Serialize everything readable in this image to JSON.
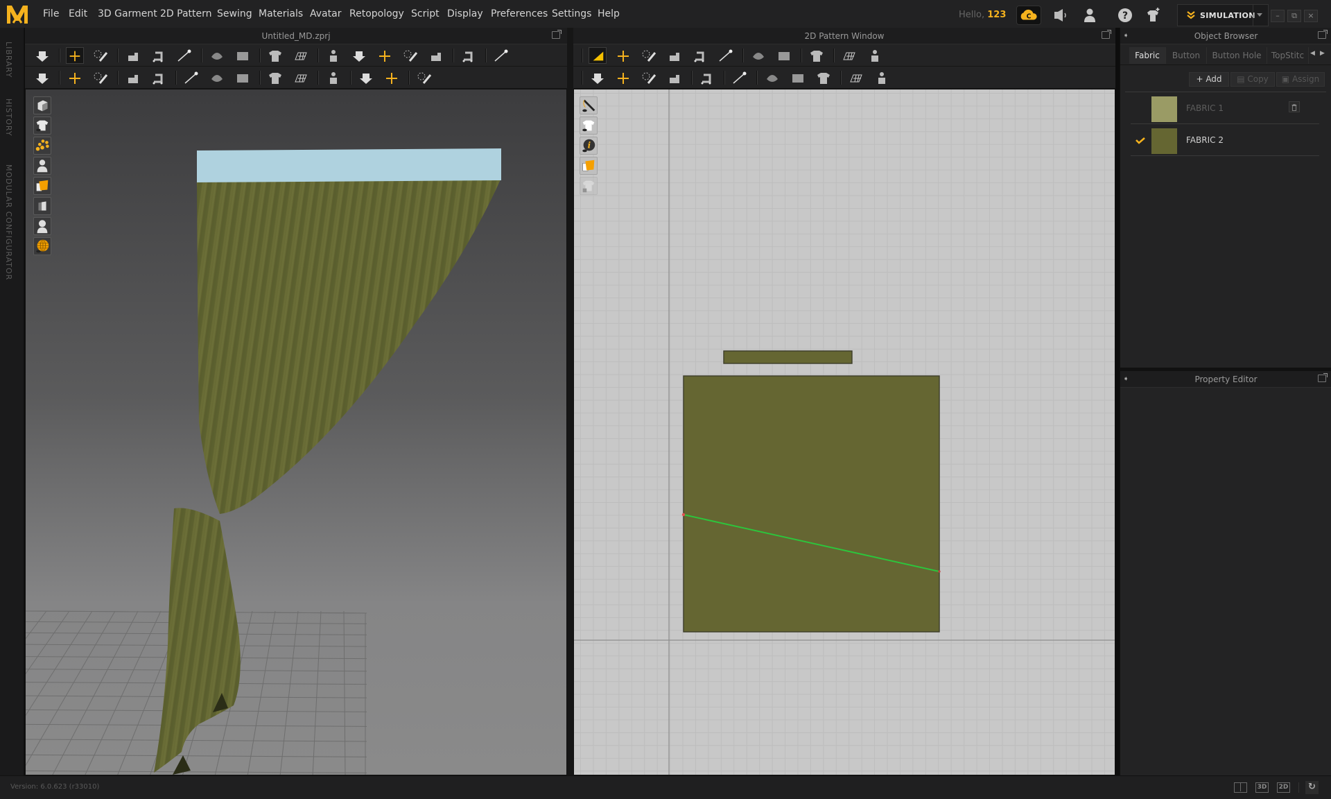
{
  "app": {
    "logo": "MD-logo",
    "menu": [
      "File",
      "Edit",
      "3D Garment",
      "2D Pattern",
      "Sewing",
      "Materials",
      "Avatar",
      "Retopology",
      "Script",
      "Display",
      "Preferences",
      "Settings",
      "Help"
    ],
    "greeting": "Hello,",
    "username": "123",
    "mode_label": "SIMULATION",
    "accent_color": "#f5b21e",
    "top_icons": [
      "cloud-icon",
      "announcement-icon",
      "user-icon",
      "help-icon",
      "add-garment-icon"
    ],
    "window_controls": [
      "minimize",
      "restore",
      "close"
    ]
  },
  "side_tabs": [
    "LIBRARY",
    "HISTORY",
    "MODULAR CONFIGURATOR"
  ],
  "view3d": {
    "title": "Untitled_MD.zprj",
    "toolbar_row1": [
      "simulation",
      "select-move",
      "select-mesh-brush",
      "segment-sewing",
      "free-sewing",
      "edit-sewing",
      "pin",
      "tack",
      "edit-curvature",
      "reset-2d-arrangement",
      "show-3d-garment",
      "show-avatar",
      "show-avatar-x-ray",
      "show-avatar-stitches",
      "steam",
      "fold",
      "texture-editor"
    ],
    "toolbar_row2": [
      "avatar-pose",
      "topstitch",
      "edit-topstitch",
      "puckering",
      "edit-puckering",
      "texture-display",
      "graphic-display",
      "fabric-texture",
      "button",
      "buttonhole",
      "zipper",
      "elastic",
      "elastic-edit",
      "measure"
    ],
    "viewport_tools": [
      "show-3d-garment",
      "show-avatar-fabric",
      "show-arrangement-points",
      "show-avatar",
      "fabric-texture",
      "garment-shading",
      "avatar-display",
      "show-grid"
    ],
    "rod_color": "#afd2df",
    "curtain_color": "#666a33"
  },
  "view2d": {
    "title": "2D Pattern Window",
    "toolbar_row1": [
      "transform-pattern",
      "edit-pattern",
      "edit-curve-point",
      "polygon",
      "rectangle",
      "internal-shape",
      "trace",
      "fold-arrangement",
      "symmetric-pattern",
      "baseline",
      "grid-texture"
    ],
    "toolbar_row2": [
      "segment-sewing",
      "free-sewing",
      "edit-sewing",
      "check-sewing",
      "steam",
      "show-pattern",
      "texture-display",
      "graphic",
      "fabric-texture",
      "line",
      "dash-line"
    ],
    "viewport_tools": [
      "show-sewing-lines",
      "show-2d-garment",
      "show-info",
      "fabric-texture",
      "lock-pattern"
    ],
    "pattern_color": "#656632",
    "sewing_line_color": "#2dc43c",
    "patterns": [
      {
        "name": "rod-band-pattern"
      },
      {
        "name": "curtain-panel-pattern"
      }
    ]
  },
  "object_browser": {
    "title": "Object Browser",
    "tabs": [
      "Fabric",
      "Button",
      "Button Hole",
      "TopStitc"
    ],
    "active_tab": "Fabric",
    "actions": {
      "add": "Add",
      "copy": "Copy",
      "assign": "Assign"
    },
    "fabrics": [
      {
        "name": "FABRIC 1",
        "color": "#9a9b65",
        "selected": false
      },
      {
        "name": "FABRIC 2",
        "color": "#656632",
        "selected": true
      }
    ]
  },
  "property_editor": {
    "title": "Property Editor"
  },
  "status": {
    "version": "Version: 6.0.623 (r33010)",
    "layout_buttons": [
      "split-view",
      "3D",
      "2D"
    ],
    "refresh": "refresh-icon"
  }
}
